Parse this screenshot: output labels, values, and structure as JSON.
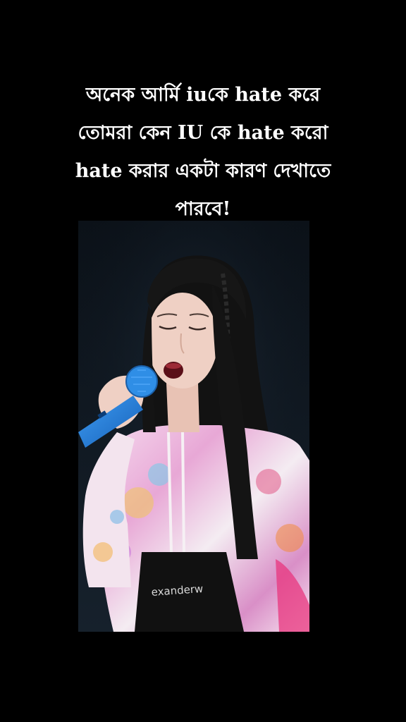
{
  "caption": {
    "lines": [
      "অনেক আর্মি iuকে hate করে",
      "তোমরা কেন IU কে hate করো",
      "hate করার একটা কারণ দেখাতে",
      "পারবে!"
    ]
  },
  "video": {
    "shirt_text": "exanderw",
    "colors": {
      "background": "#000000",
      "stage": "#0e1620",
      "microphone": "#1f7ad6",
      "hair": "#141414",
      "skin": "#efd0c4"
    }
  }
}
